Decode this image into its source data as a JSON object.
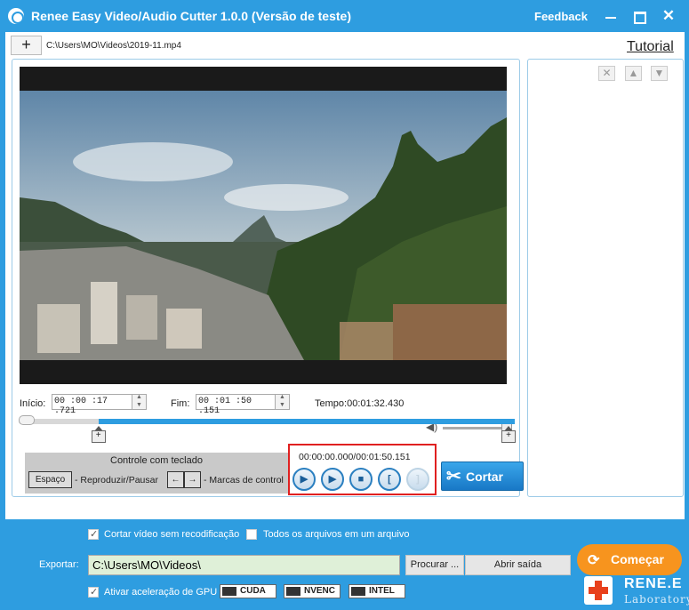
{
  "window": {
    "title": "Renee Easy Video/Audio Cutter 1.0.0 (Versão de teste)",
    "feedback": "Feedback",
    "minimize_icon": "minimize-icon",
    "maximize_icon": "maximize-icon",
    "close_label": "✕"
  },
  "toolbar": {
    "add_label": "+",
    "file_path": "C:\\Users\\MO\\Videos\\2019-11.mp4",
    "tutorial": "Tutorial"
  },
  "right_panel": {
    "remove_label": "✕",
    "up_label": "▲",
    "down_label": "▼"
  },
  "timing": {
    "start_label": "Início:",
    "start_value": "00 :00 :17 .721",
    "end_label": "Fim:",
    "end_value": "00 :01 :50 .151",
    "duration_label": "Tempo:",
    "duration_value": "00:01:32.430"
  },
  "timeline": {
    "selection_start": 0.1606,
    "selection_end": 1.0,
    "volume_level": 0.9
  },
  "keyboard": {
    "title": "Controle com teclado",
    "space_key": "Espaço",
    "space_text": "- Reproduzir/Pausar",
    "left_key": "←",
    "right_key": "→",
    "arrows_text": "- Marcas de control"
  },
  "playback": {
    "timecode": "00:00:00.000/00:01:50.151",
    "play_label": "▶",
    "play_segment_label": "▶",
    "stop_label": "■",
    "mark_start_label": "[",
    "mark_end_label": "]"
  },
  "cut_button": "Cortar",
  "options": {
    "no_reencode": "Cortar vídeo sem recodificação",
    "no_reencode_checked": true,
    "all_in_one": "Todos os arquivos em um arquivo",
    "all_in_one_checked": false,
    "gpu": "Ativar aceleração de GPU",
    "gpu_checked": true
  },
  "export": {
    "label": "Exportar:",
    "path": "C:\\Users\\MO\\Videos\\",
    "browse": "Procurar ...",
    "open_folder": "Abrir saída"
  },
  "gpu_badges": [
    "CUDA",
    "NVENC",
    "INTEL"
  ],
  "start_button": "Começar",
  "logo": {
    "name": "RENE.E",
    "sub": "Laboratory"
  },
  "colors": {
    "accent": "#2e9de0",
    "start": "#f7941e",
    "highlight_border": "#e02020",
    "export_field": "#dff0d8"
  }
}
